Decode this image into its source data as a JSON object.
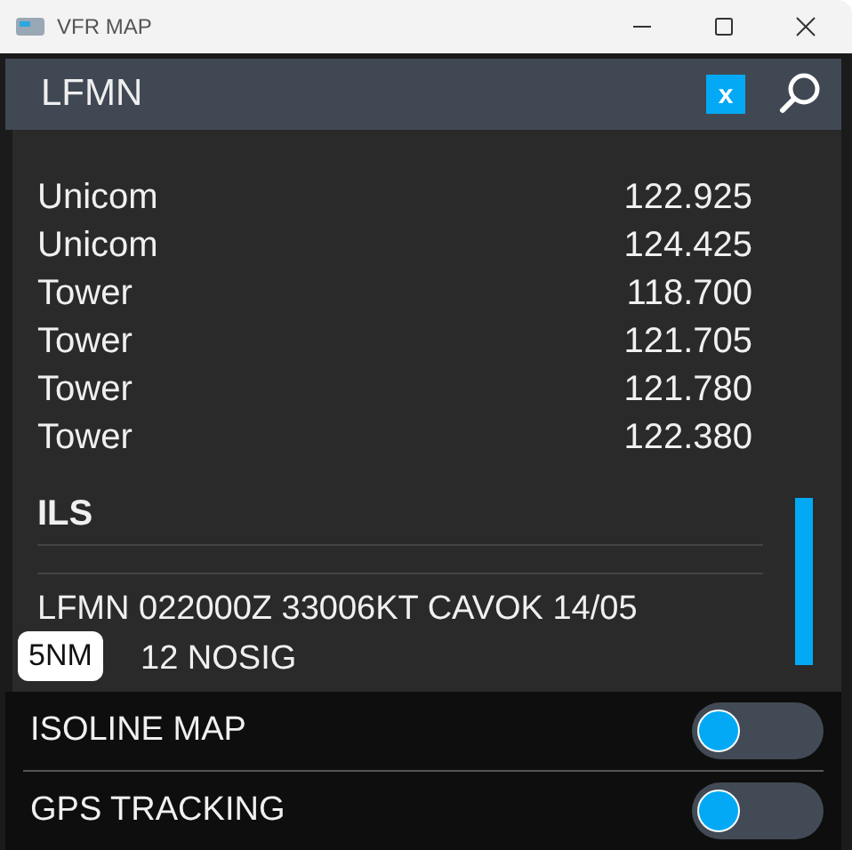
{
  "window": {
    "title": "VFR MAP"
  },
  "search": {
    "value": "LFMN",
    "clear_label": "x"
  },
  "frequencies": [
    {
      "name": "Unicom",
      "value": "122.925"
    },
    {
      "name": "Unicom",
      "value": "124.425"
    },
    {
      "name": "Tower",
      "value": "118.700"
    },
    {
      "name": "Tower",
      "value": "121.705"
    },
    {
      "name": "Tower",
      "value": "121.780"
    },
    {
      "name": "Tower",
      "value": "122.380"
    }
  ],
  "section": {
    "title": "ILS"
  },
  "metar": [
    "LFMN 022000Z 33006KT CAVOK 14/05",
    "12 NOSIG"
  ],
  "scale_badge": "5NM",
  "toggles": [
    {
      "label": "ISOLINE MAP",
      "on": false
    },
    {
      "label": "GPS TRACKING",
      "on": false
    }
  ]
}
